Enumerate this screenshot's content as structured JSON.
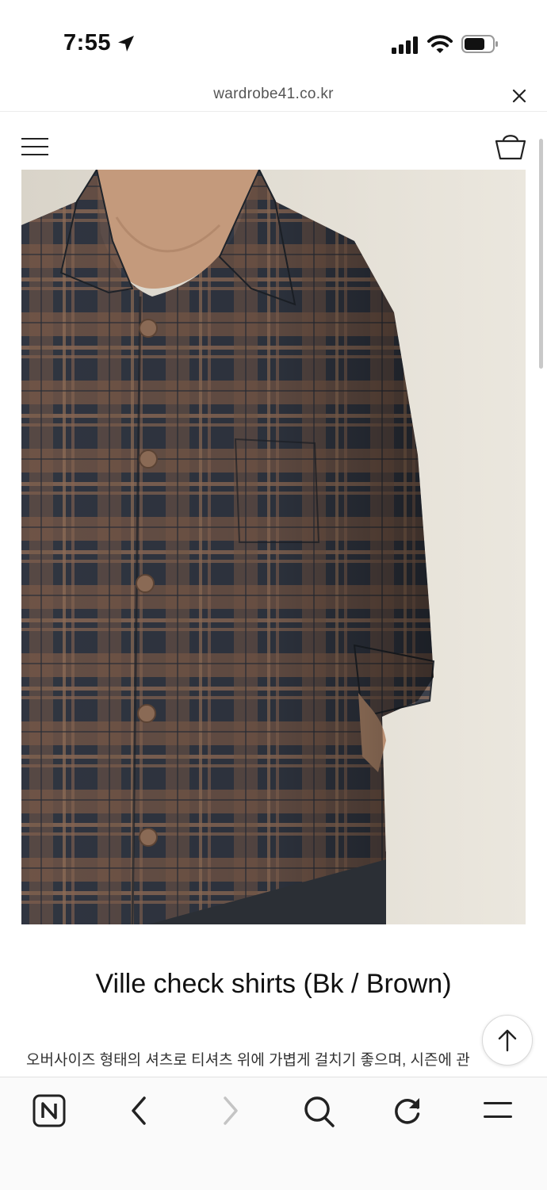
{
  "status_bar": {
    "time": "7:55",
    "icons": [
      "location-arrow-icon",
      "signal-bars-icon",
      "wifi-icon",
      "battery-icon"
    ]
  },
  "browser": {
    "url": "wardrobe41.co.kr",
    "close_icon": "close-icon"
  },
  "site_header": {
    "menu_icon": "hamburger-menu-icon",
    "cart_icon": "shopping-basket-icon"
  },
  "product": {
    "image_subject": "plaid shirt",
    "title": "Ville check shirts (Bk / Brown)",
    "description": "오버사이즈 형태의 셔츠로 티셔츠 위에 가볍게 걸치기 좋으며, 시즌에 관"
  },
  "floating": {
    "scroll_top_icon": "arrow-up-icon"
  },
  "bottom_toolbar": {
    "items": [
      "naver-home-icon",
      "back-chevron-icon",
      "forward-chevron-icon",
      "search-icon",
      "refresh-icon",
      "menu-icon"
    ]
  },
  "colors": {
    "shirt_dark": "#2f3540",
    "shirt_brown": "#8a6550",
    "wall": "#e3ded3",
    "disabled": "#c4c4c4"
  }
}
